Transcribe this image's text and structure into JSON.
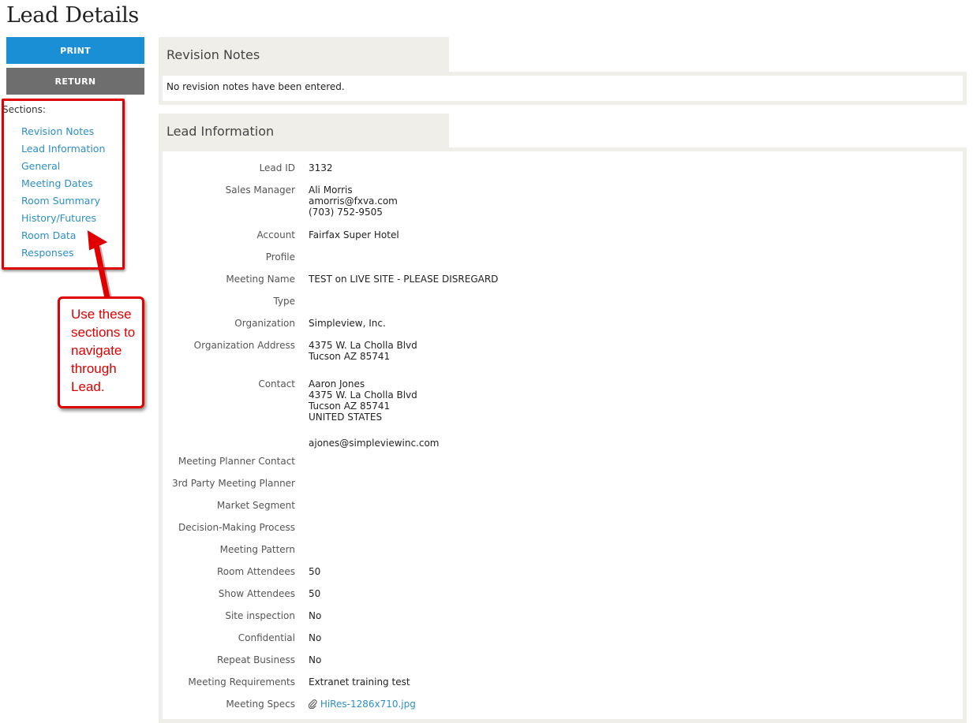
{
  "page": {
    "title": "Lead Details"
  },
  "actions": {
    "print_label": "PRINT",
    "return_label": "RETURN"
  },
  "sections": {
    "label": "Sections:",
    "items": [
      "Revision Notes",
      "Lead Information",
      "General",
      "Meeting Dates",
      "Room Summary",
      "History/Futures",
      "Room Data",
      "Responses"
    ]
  },
  "annotation": {
    "lines": [
      "Use these",
      "sections to",
      "navigate",
      "through",
      "Lead."
    ],
    "color": "#e00000"
  },
  "revision_notes": {
    "title": "Revision Notes",
    "empty_text": "No revision notes have been entered."
  },
  "lead_info": {
    "title": "Lead Information",
    "fields": {
      "lead_id": {
        "label": "Lead ID",
        "value": "3132"
      },
      "sales_manager": {
        "label": "Sales Manager",
        "lines": [
          "Ali Morris",
          "amorris@fxva.com",
          "(703) 752-9505"
        ]
      },
      "account": {
        "label": "Account",
        "value": "Fairfax Super Hotel"
      },
      "profile": {
        "label": "Profile",
        "value": ""
      },
      "meeting_name": {
        "label": "Meeting Name",
        "value": "TEST on LIVE SITE - PLEASE DISREGARD"
      },
      "type": {
        "label": "Type",
        "value": ""
      },
      "organization": {
        "label": "Organization",
        "value": "Simpleview, Inc."
      },
      "org_address": {
        "label": "Organization Address",
        "lines": [
          "4375 W. La Cholla Blvd",
          "Tucson AZ 85741"
        ]
      },
      "contact": {
        "label": "Contact",
        "lines": [
          "Aaron Jones",
          "4375 W. La Cholla Blvd",
          "Tucson AZ 85741",
          "UNITED STATES"
        ],
        "email": "ajones@simpleviewinc.com"
      },
      "meeting_planner_contact": {
        "label": "Meeting Planner Contact",
        "value": ""
      },
      "third_party_planner": {
        "label": "3rd Party Meeting Planner",
        "value": ""
      },
      "market_segment": {
        "label": "Market Segment",
        "value": ""
      },
      "decision_process": {
        "label": "Decision-Making Process",
        "value": ""
      },
      "meeting_pattern": {
        "label": "Meeting Pattern",
        "value": ""
      },
      "room_attendees": {
        "label": "Room Attendees",
        "value": "50"
      },
      "show_attendees": {
        "label": "Show Attendees",
        "value": "50"
      },
      "site_inspection": {
        "label": "Site inspection",
        "value": "No"
      },
      "confidential": {
        "label": "Confidential",
        "value": "No"
      },
      "repeat_business": {
        "label": "Repeat Business",
        "value": "No"
      },
      "meeting_requirements": {
        "label": "Meeting Requirements",
        "value": "Extranet training test"
      },
      "meeting_specs": {
        "label": "Meeting Specs",
        "file": "HiRes-1286x710.jpg",
        "icon": "paperclip-icon"
      }
    }
  }
}
